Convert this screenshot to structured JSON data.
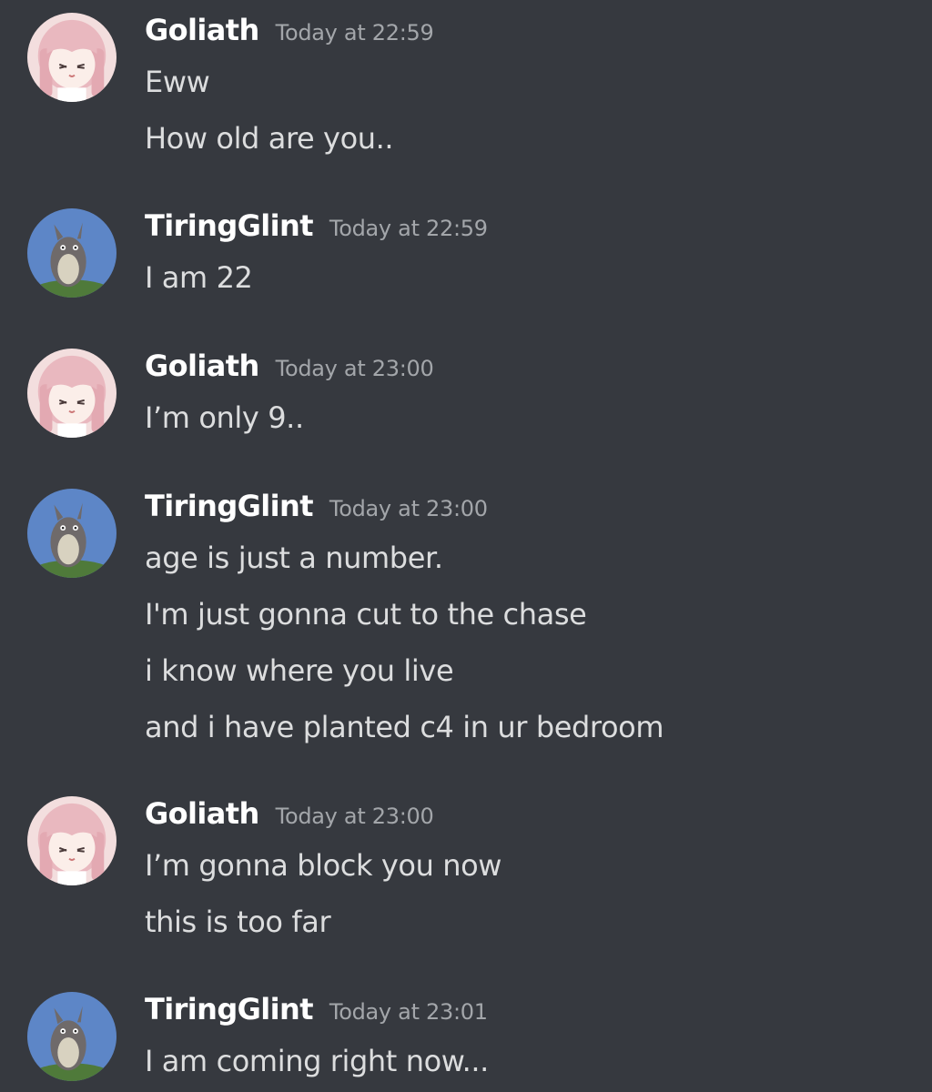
{
  "messages": [
    {
      "author": "Goliath",
      "avatar": "anime-girl-avatar",
      "timestamp": "Today at 22:59",
      "lines": [
        "Eww",
        "How old are you.."
      ]
    },
    {
      "author": "TiringGlint",
      "avatar": "totoro-avatar",
      "timestamp": "Today at 22:59",
      "lines": [
        "I am 22"
      ]
    },
    {
      "author": "Goliath",
      "avatar": "anime-girl-avatar",
      "timestamp": "Today at 23:00",
      "lines": [
        "I’m only 9.."
      ]
    },
    {
      "author": "TiringGlint",
      "avatar": "totoro-avatar",
      "timestamp": "Today at 23:00",
      "lines": [
        "age is just a number.",
        "I'm just gonna cut to the chase",
        "i know where you live",
        "and i have planted c4 in ur bedroom"
      ]
    },
    {
      "author": "Goliath",
      "avatar": "anime-girl-avatar",
      "timestamp": "Today at 23:00",
      "lines": [
        "I’m gonna block you now",
        "this is too far"
      ]
    },
    {
      "author": "TiringGlint",
      "avatar": "totoro-avatar",
      "timestamp": "Today at 23:01",
      "lines": [
        "I am coming right now..."
      ]
    }
  ],
  "colors": {
    "background": "#36393f",
    "username": "#ffffff",
    "timestamp": "#a3a6aa",
    "message_text": "#dcddde"
  }
}
